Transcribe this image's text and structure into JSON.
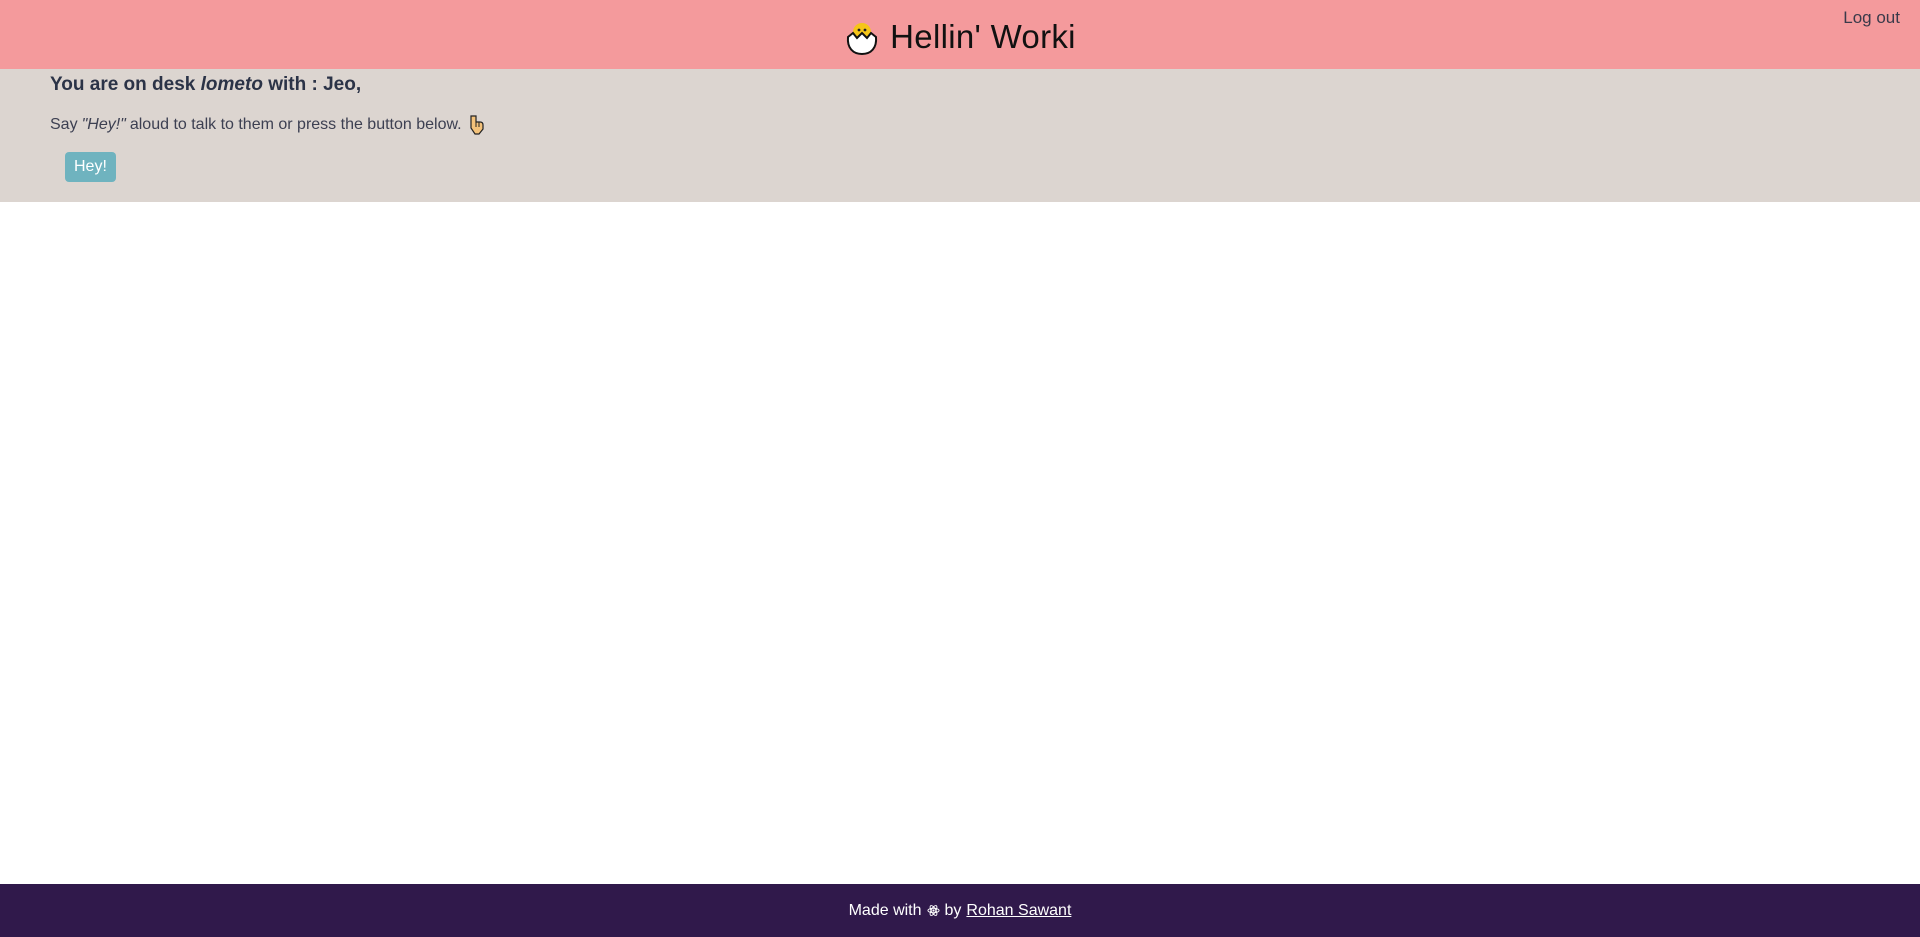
{
  "header": {
    "title": "Hellin' Worki",
    "logout_label": "Log out",
    "logo_icon": "hatching-chick-icon",
    "background": "#f49a9c"
  },
  "desk": {
    "heading_prefix": "You are on desk",
    "desk_name": "lometo",
    "heading_suffix": "with : Jeo,",
    "hint_prefix": "Say",
    "hint_quote": "\"Hey!\"",
    "hint_suffix": "aloud to talk to them or press the button below.",
    "hint_icon": "pointing-down-icon",
    "button_label": "Hey!",
    "background": "#dcd5d0",
    "button_color": "#6fb3bf"
  },
  "footer": {
    "made_with": "Made with",
    "by": "by",
    "icon": "atom-icon",
    "author": "Rohan Sawant",
    "background": "#30194b"
  }
}
